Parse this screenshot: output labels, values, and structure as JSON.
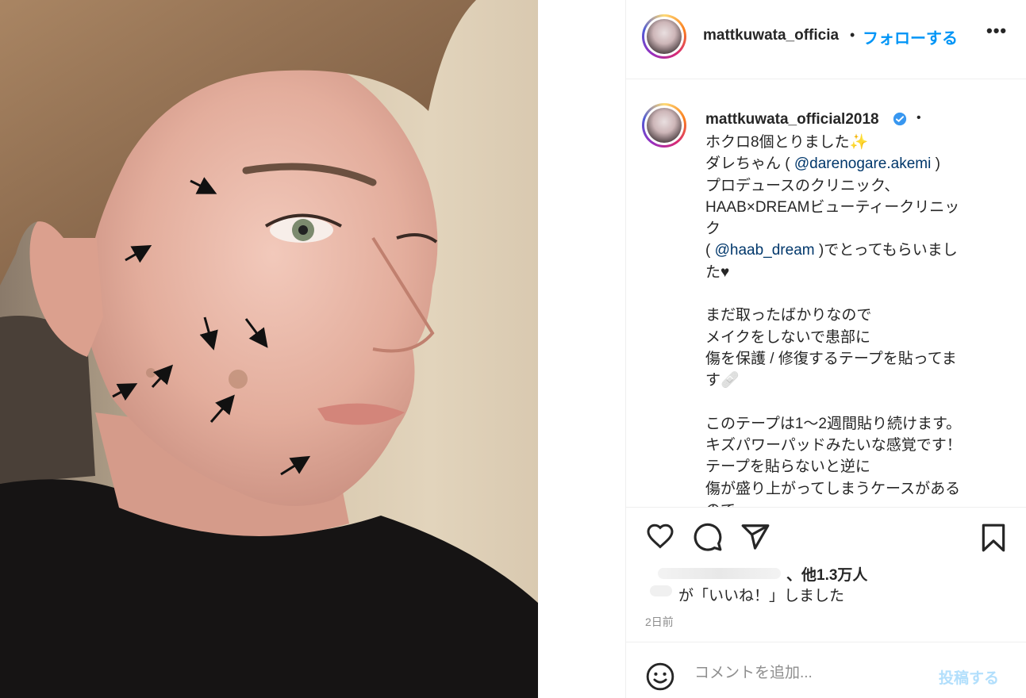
{
  "header": {
    "username": "mattkuwata_officia",
    "separator": "•",
    "follow_label": "フォローする",
    "more_label": "•••"
  },
  "caption": {
    "username": "mattkuwata_official2018",
    "separator": "•",
    "lines": [
      "ホクロ8個とりました✨",
      "ダレちゃん ( ",
      "プロデュースのクリニック、",
      "HAAB×DREAMビューティークリニッ",
      "ク",
      "( ",
      "た♥",
      "",
      "まだ取ったばかりなので",
      "メイクをしないで患部に",
      "傷を保護 / 修復するテープを貼ってま",
      "す🩹",
      "",
      "このテープは1〜2週間貼り続けます。",
      "キズパワーパッドみたいな感覚です！",
      "テープを貼らないと逆に",
      "傷が盛り上がってしまうケースがある",
      "ので"
    ],
    "mention_1": "@darenogare.akemi",
    "mention_1_suffix": " )",
    "mention_2": "@haab_dream",
    "mention_2_suffix": " )でとってもらいまし"
  },
  "likes": {
    "count_text": "、他1.3万人",
    "liked_text": "が「いいね！」しました"
  },
  "timestamp": "2日前",
  "comment": {
    "placeholder": "コメントを追加...",
    "post_label": "投稿する"
  },
  "colors": {
    "accent": "#0095f6",
    "post_disabled": "#b2dffc",
    "mention": "#00376b"
  },
  "icons": [
    "heart-icon",
    "comment-icon",
    "share-icon",
    "bookmark-icon",
    "emoji-icon",
    "verified-icon"
  ]
}
